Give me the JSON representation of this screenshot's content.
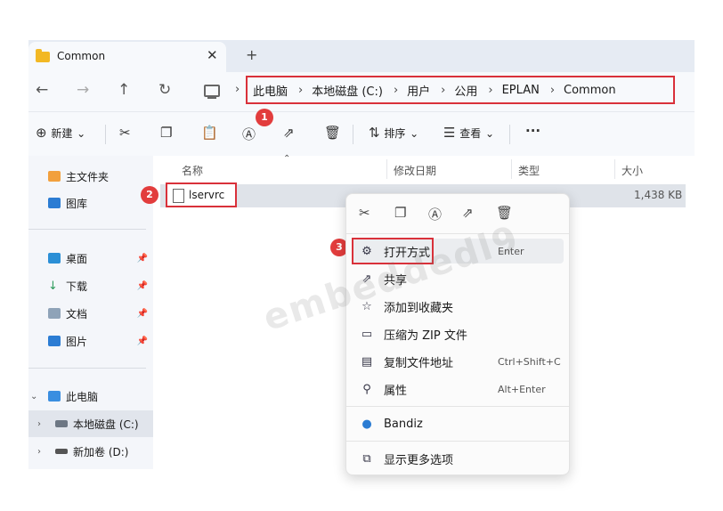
{
  "tab": {
    "title": "Common",
    "close": "✕",
    "new": "+"
  },
  "nav": {
    "back": "←",
    "forward": "→",
    "up": "↑",
    "refresh": "↻"
  },
  "breadcrumb": {
    "items": [
      "此电脑",
      "本地磁盘 (C:)",
      "用户",
      "公用",
      "EPLAN",
      "Common"
    ],
    "separator": "›"
  },
  "toolbar": {
    "new_label": "新建",
    "sort_label": "排序",
    "view_label": "查看",
    "more": "···"
  },
  "badges": [
    "1",
    "2",
    "3"
  ],
  "sidebar": {
    "items": [
      {
        "label": "主文件夹"
      },
      {
        "label": "图库"
      },
      {
        "label": "桌面"
      },
      {
        "label": "下载"
      },
      {
        "label": "文档"
      },
      {
        "label": "图片"
      },
      {
        "label": "此电脑"
      },
      {
        "label": "本地磁盘 (C:)"
      },
      {
        "label": "新加卷 (D:)"
      }
    ]
  },
  "columns": [
    "名称",
    "修改日期",
    "类型",
    "大小"
  ],
  "file": {
    "name": "lservrc",
    "size": "1,438 KB"
  },
  "context_menu": {
    "items": [
      {
        "label": "打开方式",
        "shortcut": "Enter"
      },
      {
        "label": "共享",
        "shortcut": ""
      },
      {
        "label": "添加到收藏夹",
        "shortcut": ""
      },
      {
        "label": "压缩为 ZIP 文件",
        "shortcut": ""
      },
      {
        "label": "复制文件地址",
        "shortcut": "Ctrl+Shift+C"
      },
      {
        "label": "属性",
        "shortcut": "Alt+Enter"
      },
      {
        "label": "Bandiz",
        "shortcut": ""
      },
      {
        "label": "显示更多选项",
        "shortcut": ""
      }
    ]
  },
  "watermark": "embeddedl9",
  "colors": {
    "highlight_red": "#d9313a",
    "badge_red": "#e23d3d",
    "folder": "#f2b824",
    "accent_blue": "#2b7cd3"
  }
}
